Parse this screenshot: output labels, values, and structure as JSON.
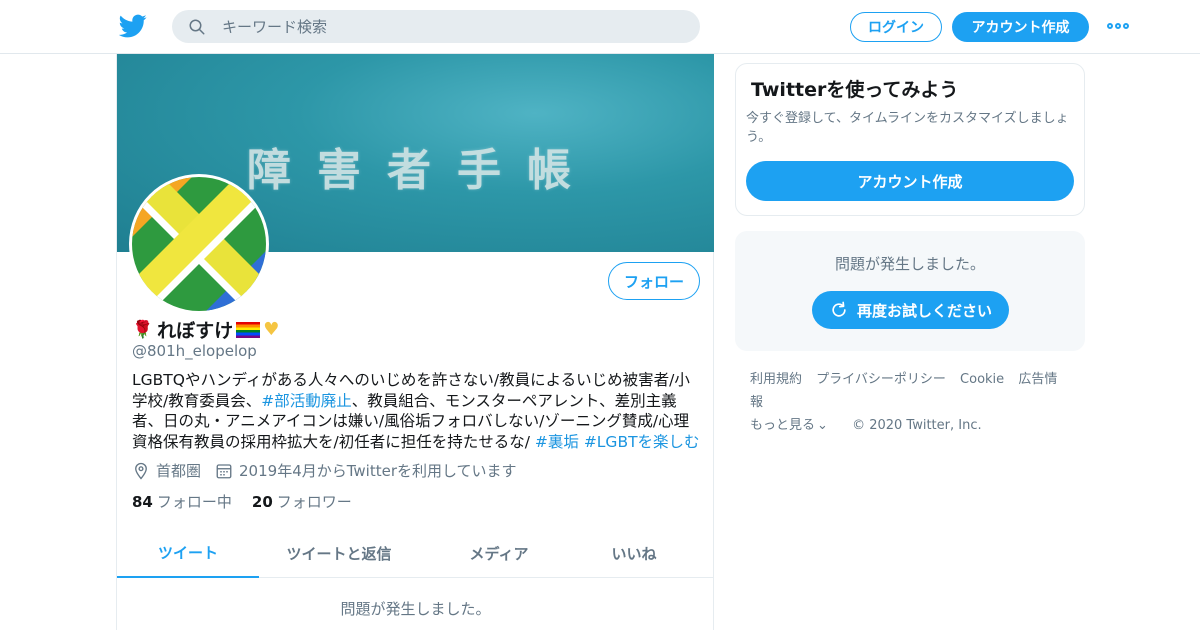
{
  "topbar": {
    "search_placeholder": "キーワード検索",
    "login_label": "ログイン",
    "signup_label": "アカウント作成"
  },
  "profile": {
    "banner_text": "障害者手帳",
    "follow_label": "フォロー",
    "display_name": "れぼすけ",
    "handle": "@801h_elopelop",
    "bio_parts": [
      {
        "text": "LGBTQやハンディがある人々へのいじめを許さない/教員によるいじめ被害者/小学校/教育委員会、",
        "tag": false
      },
      {
        "text": "#部活動廃止",
        "tag": true
      },
      {
        "text": "、教員組合、モンスターペアレント、差別主義者、日の丸・アニメアイコンは嫌い/風俗垢フォロバしない/ゾーニング賛成/心理資格保有教員の採用枠拡大を/初任者に担任を持たせるな/ ",
        "tag": false
      },
      {
        "text": "#裏垢",
        "tag": true
      },
      {
        "text": " ",
        "tag": false
      },
      {
        "text": "#LGBTを楽しむ",
        "tag": true
      }
    ],
    "location": "首都圏",
    "joined": "2019年4月からTwitterを利用しています",
    "following_count": "84",
    "following_label": "フォロー中",
    "followers_count": "20",
    "followers_label": "フォロワー",
    "tabs": [
      "ツイート",
      "ツイートと返信",
      "メディア",
      "いいね"
    ],
    "active_tab": 0,
    "error_message": "問題が発生しました。"
  },
  "sidebar": {
    "card_title": "Twitterを使ってみよう",
    "card_desc": "今すぐ登録して、タイムラインをカスタマイズしましょう。",
    "card_button": "アカウント作成",
    "error_message": "問題が発生しました。",
    "retry_label": "再度お試しください"
  },
  "footer": {
    "links": [
      "利用規約",
      "プライバシーポリシー",
      "Cookie",
      "広告情報",
      "もっと見る"
    ],
    "copyright": "© 2020 Twitter, Inc."
  },
  "colors": {
    "accent": "#1da1f2",
    "text_secondary": "#657786"
  }
}
